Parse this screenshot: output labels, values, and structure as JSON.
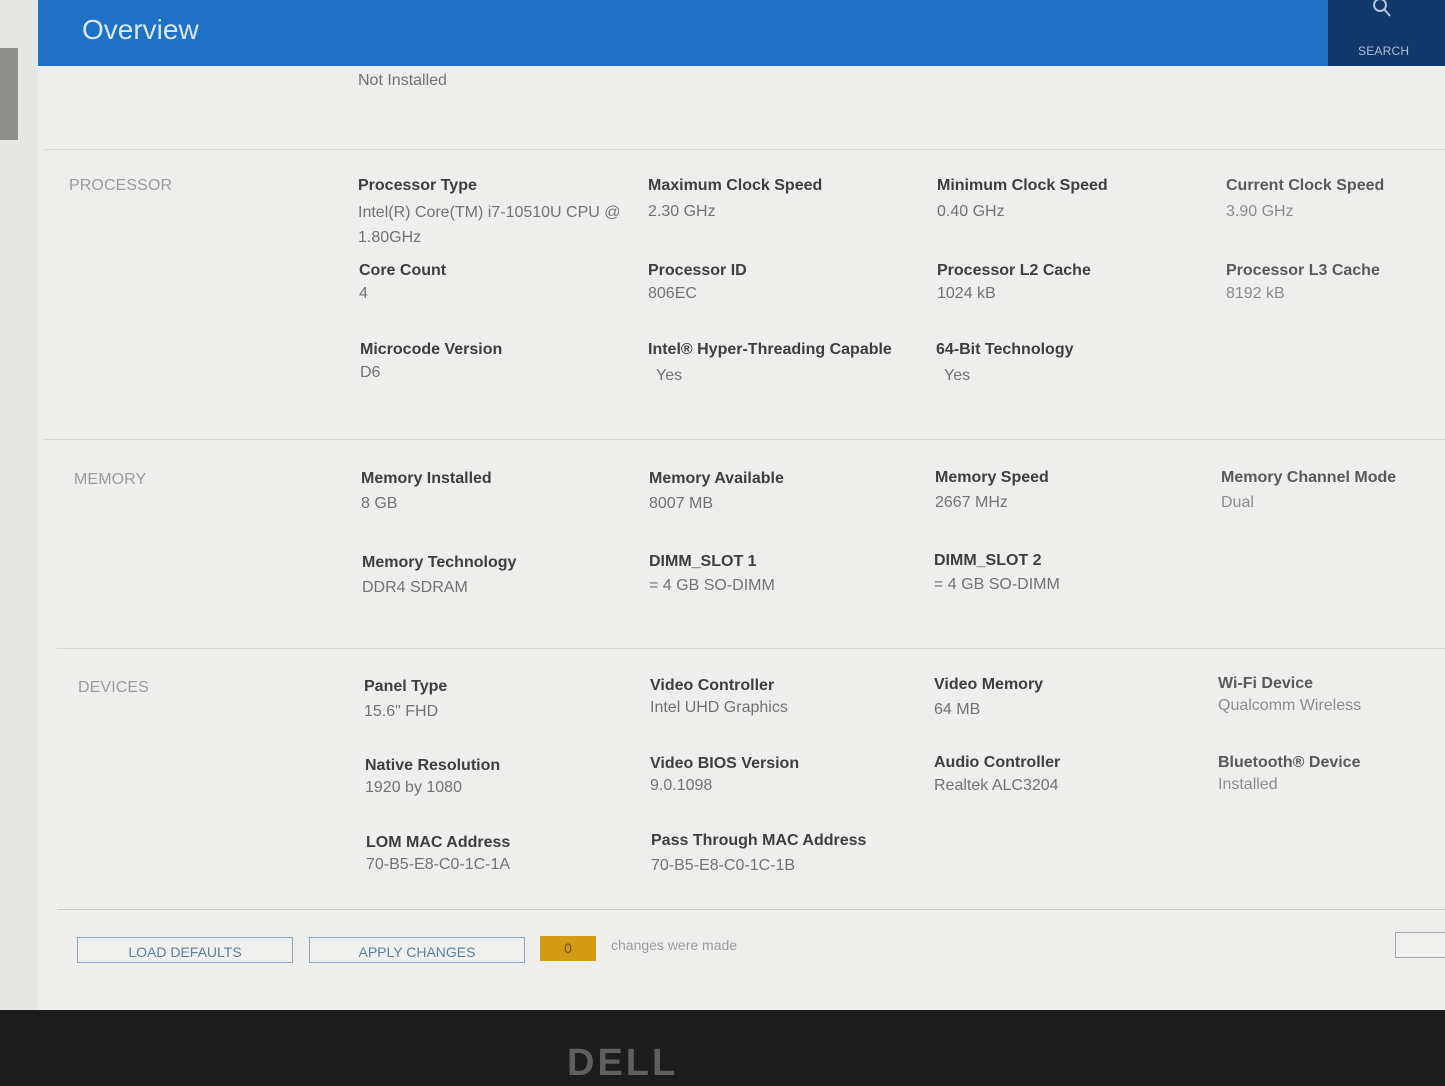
{
  "header": {
    "title": "Overview",
    "search_label": "SEARCH",
    "search_icon": "search-icon"
  },
  "previous_value": "Not Installed",
  "sections": {
    "processor": {
      "title": "PROCESSOR",
      "fields": [
        {
          "label": "Processor Type",
          "value": "Intel(R) Core(TM) i7-10510U CPU @ 1.80GHz"
        },
        {
          "label": "Maximum Clock Speed",
          "value": "2.30 GHz"
        },
        {
          "label": "Minimum Clock Speed",
          "value": "0.40 GHz"
        },
        {
          "label": "Current Clock Speed",
          "value": "3.90 GHz"
        },
        {
          "label": "Core Count",
          "value": "4"
        },
        {
          "label": "Processor ID",
          "value": "806EC"
        },
        {
          "label": "Processor L2 Cache",
          "value": "1024 kB"
        },
        {
          "label": "Processor L3 Cache",
          "value": "8192 kB"
        },
        {
          "label": "Microcode Version",
          "value": "D6"
        },
        {
          "label": "Intel® Hyper-Threading Capable",
          "value": "Yes"
        },
        {
          "label": "64-Bit Technology",
          "value": "Yes"
        }
      ]
    },
    "memory": {
      "title": "MEMORY",
      "fields": [
        {
          "label": "Memory Installed",
          "value": "8 GB"
        },
        {
          "label": "Memory Available",
          "value": "8007 MB"
        },
        {
          "label": "Memory Speed",
          "value": "2667 MHz"
        },
        {
          "label": "Memory Channel Mode",
          "value": "Dual"
        },
        {
          "label": "Memory Technology",
          "value": "DDR4 SDRAM"
        },
        {
          "label": "DIMM_SLOT 1",
          "value": "= 4 GB SO-DIMM"
        },
        {
          "label": "DIMM_SLOT 2",
          "value": "= 4 GB SO-DIMM"
        }
      ]
    },
    "devices": {
      "title": "DEVICES",
      "fields": [
        {
          "label": "Panel Type",
          "value": "15.6\" FHD"
        },
        {
          "label": "Video Controller",
          "value": "Intel UHD Graphics"
        },
        {
          "label": "Video Memory",
          "value": "64 MB"
        },
        {
          "label": "Wi-Fi Device",
          "value": "Qualcomm Wireless"
        },
        {
          "label": "Native Resolution",
          "value": "1920 by 1080"
        },
        {
          "label": "Video BIOS Version",
          "value": "9.0.1098"
        },
        {
          "label": "Audio Controller",
          "value": "Realtek ALC3204"
        },
        {
          "label": "Bluetooth® Device",
          "value": "Installed"
        },
        {
          "label": "LOM MAC Address",
          "value": "70-B5-E8-C0-1C-1A"
        },
        {
          "label": "Pass Through MAC Address",
          "value": "70-B5-E8-C0-1C-1B"
        }
      ]
    }
  },
  "footer": {
    "load_defaults": "LOAD DEFAULTS",
    "apply_changes": "APPLY CHANGES",
    "changes_count": "0",
    "changes_text": "changes were made"
  },
  "bezel": {
    "logo": "DELL"
  }
}
